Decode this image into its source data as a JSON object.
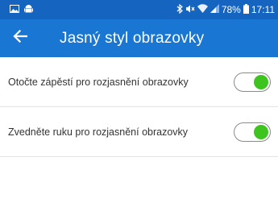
{
  "status_bar": {
    "left_icons": [
      "image-icon",
      "android-icon"
    ],
    "right_icons": [
      "bluetooth-icon",
      "mute-icon",
      "wifi-icon",
      "signal-icon",
      "battery-icon"
    ],
    "battery_text": "78%",
    "time": "17:11",
    "color": "#1565c0"
  },
  "app_bar": {
    "back_icon": "arrow-back-icon",
    "title": "Jasný styl obrazovky",
    "color": "#1976d2"
  },
  "settings": [
    {
      "label": "Otočte zápěstí pro rozjasnění obrazovky",
      "enabled": true
    },
    {
      "label": "Zvedněte ruku pro rozjasnění obrazovky",
      "enabled": true
    }
  ],
  "toggle_on_color": "#3ec41f"
}
